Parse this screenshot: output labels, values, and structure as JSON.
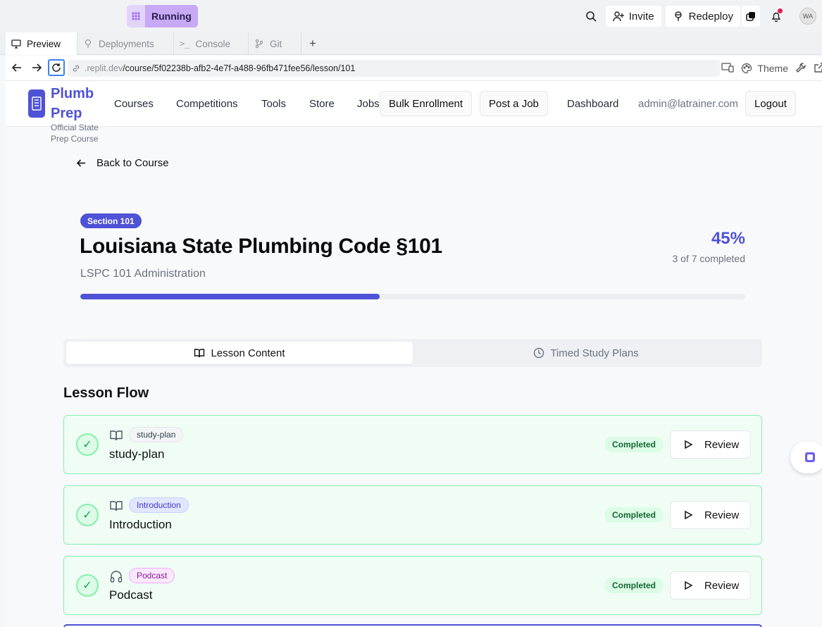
{
  "replit": {
    "run_status": "Running",
    "invite_label": "Invite",
    "redeploy_label": "Redeploy",
    "avatar_initials": "WA",
    "tabs": [
      {
        "label": "Preview",
        "active": true
      },
      {
        "label": "Deployments",
        "active": false
      },
      {
        "label": "Console",
        "active": false
      },
      {
        "label": "Git",
        "active": false
      }
    ],
    "url_host": ".replit.dev",
    "url_path": "/course/5f02238b-afb2-4e7f-a488-96fb471fee56/lesson/101",
    "theme_label": "Theme"
  },
  "app": {
    "brand": {
      "name": "Plumb Prep",
      "tagline": "Official State Prep Course"
    },
    "nav": {
      "links": [
        "Courses",
        "Competitions",
        "Tools",
        "Store",
        "Jobs"
      ],
      "bulk_enrollment": "Bulk Enrollment",
      "post_job": "Post a Job",
      "dashboard": "Dashboard",
      "email": "admin@latrainer.com",
      "logout": "Logout"
    },
    "back_label": "Back to Course",
    "lesson": {
      "section_badge": "Section 101",
      "title": "Louisiana State Plumbing Code §101",
      "subtitle": "LSPC 101 Administration",
      "progress_percent_label": "45%",
      "progress_fraction": 0.45,
      "completed_text": "3 of 7 completed"
    },
    "content_tabs": {
      "lesson_content": "Lesson Content",
      "timed_study_plans": "Timed Study Plans"
    },
    "flow_heading": "Lesson Flow",
    "flow_items": [
      {
        "tag": "study-plan",
        "name": "study-plan",
        "icon": "book-open-icon",
        "status": "Completed",
        "action": "Review"
      },
      {
        "tag": "Introduction",
        "name": "Introduction",
        "icon": "book-open-icon",
        "status": "Completed",
        "action": "Review"
      },
      {
        "tag": "Podcast",
        "name": "Podcast",
        "icon": "headphones-icon",
        "status": "Completed",
        "action": "Review"
      }
    ],
    "colors": {
      "accent": "#4f52d6",
      "success_bg": "#f0fdf4",
      "success_border": "#86efac"
    }
  }
}
